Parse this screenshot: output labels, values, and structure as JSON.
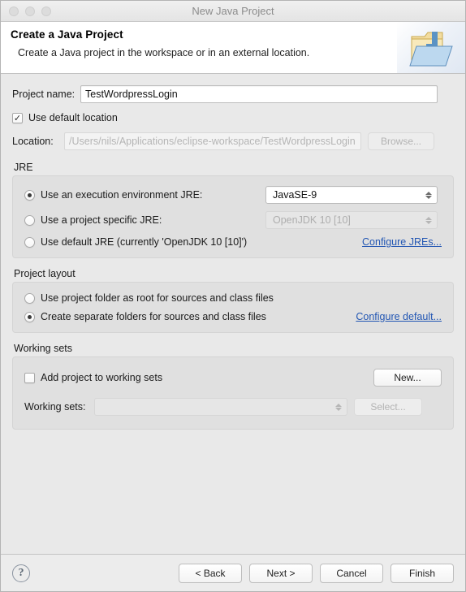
{
  "window": {
    "title": "New Java Project",
    "traffic_lights": [
      "close-button",
      "minimize-button",
      "maximize-button"
    ]
  },
  "header": {
    "title": "Create a Java Project",
    "subtitle": "Create a Java project in the workspace or in an external location.",
    "icon": "java-project-folder-icon"
  },
  "project": {
    "name_label": "Project name:",
    "name_value": "TestWordpressLogin",
    "use_default_location_label": "Use default location",
    "use_default_location_checked": true,
    "location_label": "Location:",
    "location_value": "/Users/nils/Applications/eclipse-workspace/TestWordpressLogin",
    "location_enabled": false,
    "browse_label": "Browse...",
    "browse_enabled": false
  },
  "jre": {
    "group_label": "JRE",
    "options": [
      {
        "label": "Use an execution environment JRE:",
        "selected": true
      },
      {
        "label": "Use a project specific JRE:",
        "selected": false
      },
      {
        "label": "Use default JRE (currently 'OpenJDK 10 [10]')",
        "selected": false
      }
    ],
    "execution_env_value": "JavaSE-9",
    "execution_env_enabled": true,
    "project_jre_value": "OpenJDK 10 [10]",
    "project_jre_enabled": false,
    "configure_link": "Configure JREs..."
  },
  "layout": {
    "group_label": "Project layout",
    "options": [
      {
        "label": "Use project folder as root for sources and class files",
        "selected": false
      },
      {
        "label": "Create separate folders for sources and class files",
        "selected": true
      }
    ],
    "configure_link": "Configure default..."
  },
  "working_sets": {
    "group_label": "Working sets",
    "add_label": "Add project to working sets",
    "add_checked": false,
    "new_label": "New...",
    "new_enabled": true,
    "sets_label": "Working sets:",
    "sets_value": "",
    "sets_enabled": false,
    "select_label": "Select...",
    "select_enabled": false
  },
  "footer": {
    "help_icon": "question-mark-icon",
    "back_label": "< Back",
    "next_label": "Next >",
    "cancel_label": "Cancel",
    "finish_label": "Finish"
  },
  "colors": {
    "dialog_bg": "#e9e9e9",
    "group_bg": "#e0e0e0",
    "link": "#2256b3",
    "title_text": "#8c8c8c",
    "disabled_text": "#b3b3b3"
  }
}
